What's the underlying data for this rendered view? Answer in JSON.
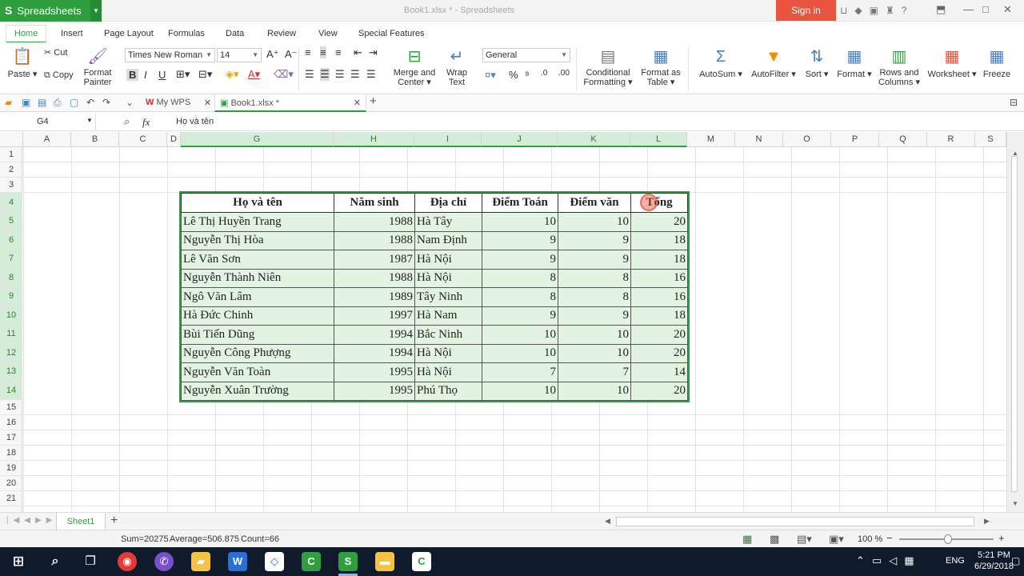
{
  "app": {
    "name": "Spreadsheets",
    "window_title": "Book1.xlsx * - Spreadsheets",
    "sign_in": "Sign in"
  },
  "menu": [
    "Home",
    "Insert",
    "Page Layout",
    "Formulas",
    "Data",
    "Review",
    "View",
    "Special Features"
  ],
  "ribbon": {
    "paste": "Paste",
    "cut": "Cut",
    "copy": "Copy",
    "format_painter_1": "Format",
    "format_painter_2": "Painter",
    "font_name": "Times New Roman",
    "font_size": "14",
    "merge_1": "Merge and",
    "merge_2": "Center",
    "wrap_1": "Wrap",
    "wrap_2": "Text",
    "number_format": "General",
    "cond_1": "Conditional",
    "cond_2": "Formatting",
    "fat_1": "Format as",
    "fat_2": "Table",
    "autosum": "AutoSum",
    "autofilter": "AutoFilter",
    "sort": "Sort",
    "format": "Format",
    "rows_1": "Rows and",
    "rows_2": "Columns",
    "worksheet": "Worksheet",
    "freeze": "Freeze"
  },
  "doc_tabs": {
    "mywps": "My WPS",
    "book": "Book1.xlsx *"
  },
  "formula_bar": {
    "name_box": "G4",
    "fx": "fx",
    "content": "Họ và tên"
  },
  "columns": [
    "A",
    "B",
    "C",
    "D",
    "G",
    "H",
    "I",
    "J",
    "K",
    "L",
    "M",
    "N",
    "O",
    "P",
    "Q",
    "R",
    "S"
  ],
  "rows": [
    "1",
    "2",
    "3",
    "4",
    "5",
    "6",
    "7",
    "8",
    "9",
    "10",
    "11",
    "12",
    "13",
    "14",
    "15",
    "16",
    "17",
    "18",
    "19",
    "20",
    "21"
  ],
  "table": {
    "headers": [
      "Họ và tên",
      "Năm sinh",
      "Địa chỉ",
      "Điểm Toán",
      "Điểm văn",
      "Tổng"
    ],
    "rows": [
      [
        "Lê Thị Huyền Trang",
        "1988",
        "Hà Tây",
        "10",
        "10",
        "20"
      ],
      [
        "Nguyễn Thị Hòa",
        "1988",
        "Nam Định",
        "9",
        "9",
        "18"
      ],
      [
        "Lê Văn Sơn",
        "1987",
        "Hà Nội",
        "9",
        "9",
        "18"
      ],
      [
        "Nguyễn Thành Niên",
        "1988",
        "Hà Nội",
        "8",
        "8",
        "16"
      ],
      [
        "Ngô Văn Lâm",
        "1989",
        "Tây Ninh",
        "8",
        "8",
        "16"
      ],
      [
        "Hà Đức Chinh",
        "1997",
        "Hà Nam",
        "9",
        "9",
        "18"
      ],
      [
        "Bùi Tiến Dũng",
        "1994",
        "Bắc Ninh",
        "10",
        "10",
        "20"
      ],
      [
        "Nguyễn Công Phượng",
        "1994",
        "Hà Nội",
        "10",
        "10",
        "20"
      ],
      [
        "Nguyễn Văn Toàn",
        "1995",
        "Hà Nội",
        "7",
        "7",
        "14"
      ],
      [
        "Nguyễn Xuân Trường",
        "1995",
        "Phú Thọ",
        "10",
        "10",
        "20"
      ]
    ]
  },
  "sheet_tab": "Sheet1",
  "status": {
    "sum": "Sum=20275",
    "average": "Average=506.875",
    "count": "Count=66",
    "zoom": "100 %"
  },
  "taskbar": {
    "lang": "ENG",
    "time": "5:21 PM",
    "date": "6/29/2018"
  },
  "colors": {
    "accent": "#2e9e3f",
    "signin": "#e8543f",
    "table_fill": "#e3f3e1"
  }
}
